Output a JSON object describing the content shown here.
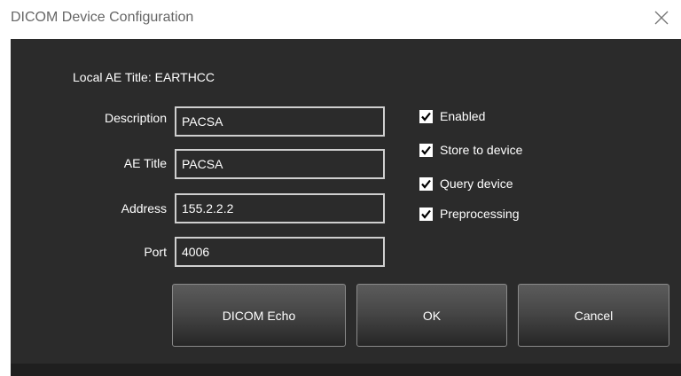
{
  "window": {
    "title": "DICOM Device Configuration",
    "close_icon": "close-icon"
  },
  "local_ae": {
    "text": "Local AE Title: EARTHCC"
  },
  "fields": {
    "description": {
      "label": "Description",
      "value": "PACSA"
    },
    "ae_title": {
      "label": "AE Title",
      "value": "PACSA"
    },
    "address": {
      "label": "Address",
      "value": "155.2.2.2"
    },
    "port": {
      "label": "Port",
      "value": "4006"
    }
  },
  "options": {
    "enabled": {
      "label": "Enabled",
      "checked": true
    },
    "store": {
      "label": "Store to device",
      "checked": true
    },
    "query": {
      "label": "Query device",
      "checked": true
    },
    "preprocessing": {
      "label": "Preprocessing",
      "checked": true
    }
  },
  "buttons": {
    "echo": "DICOM Echo",
    "ok": "OK",
    "cancel": "Cancel"
  },
  "colors": {
    "panel_bg": "#2b2b2b",
    "text": "#ffffff",
    "field_border": "#cfcfcf"
  }
}
